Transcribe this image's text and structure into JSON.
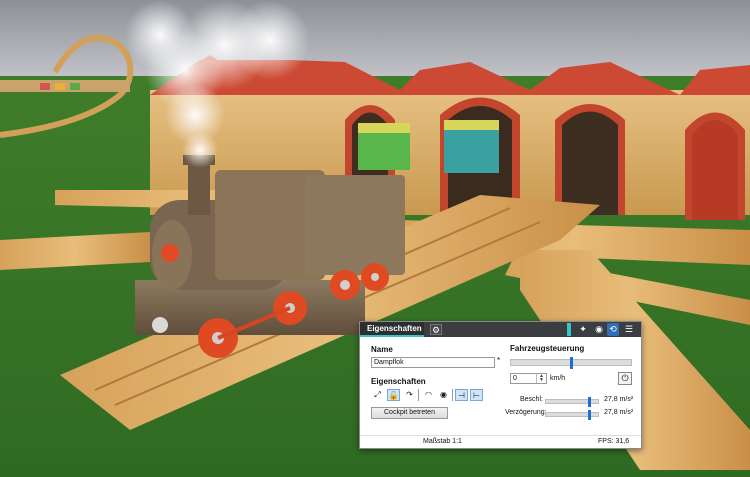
{
  "panel": {
    "tab_title": "Eigenschaften",
    "name_label": "Name",
    "name_value": "Dampflok",
    "name_required_mark": "*",
    "properties_label": "Eigenschaften",
    "cockpit_button": "Cockpit betreten",
    "header_icons": [
      "gear-icon",
      "pin-icon",
      "eye-icon",
      "link-icon",
      "menu-icon"
    ]
  },
  "control": {
    "title": "Fahrzeugsteuerung",
    "speed_value": "0",
    "speed_unit": "km/h",
    "throttle_level": 0.5,
    "acceleration_label": "Beschl:",
    "acceleration_value": "27,8 m/s²",
    "acceleration_level": 0.82,
    "deceleration_label": "Verzögerung:",
    "deceleration_value": "27,8 m/s²",
    "deceleration_level": 0.82
  },
  "footer": {
    "scale": "Maßstab 1:1",
    "fps": "FPS: 31,6"
  }
}
